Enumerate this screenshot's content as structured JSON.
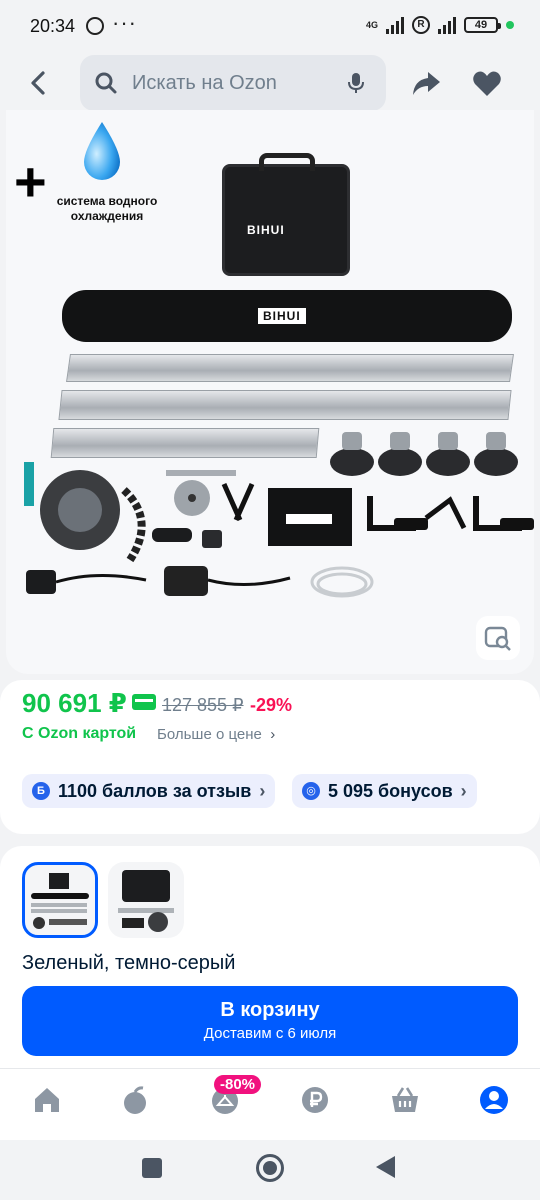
{
  "status_bar": {
    "time": "20:34",
    "network": "4G",
    "battery": "49"
  },
  "header": {
    "search_placeholder": "Искать на Ozon"
  },
  "product_image": {
    "overlay_text": "система водного охлаждения",
    "brand_logo": "BIHUI"
  },
  "price": {
    "current": "90 691 ₽",
    "old": "127 855 ₽",
    "discount": "-29%",
    "ozon_card": "С Ozon картой",
    "more_link": "Больше о цене"
  },
  "chips": [
    {
      "icon_text": "Б",
      "label": "1100 баллов за отзыв"
    },
    {
      "icon_text": "◎",
      "label": "5 095 бонусов"
    }
  ],
  "variant": {
    "color": "Зеленый, темно-серый"
  },
  "cart_button": {
    "title": "В корзину",
    "subtitle": "Доставим с 6 июля"
  },
  "bottom_nav": {
    "badge": "-80%"
  },
  "colors": {
    "accent": "#005bff",
    "price": "#10c44c",
    "discount": "#f91155",
    "badge": "#f1117e"
  }
}
